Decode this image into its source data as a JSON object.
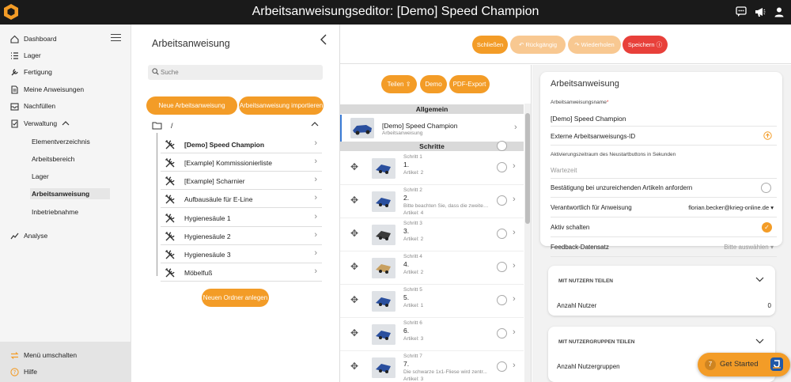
{
  "app": {
    "title": "Arbeitsanweisungseditor: [Demo] Speed Champion"
  },
  "sidebar": {
    "items": [
      {
        "label": "Dashboard",
        "icon": "dashboard-icon"
      },
      {
        "label": "Lager",
        "icon": "list-icon"
      },
      {
        "label": "Fertigung",
        "icon": "wrench-icon"
      },
      {
        "label": "Meine Anweisungen",
        "icon": "document-icon"
      },
      {
        "label": "Nachfüllen",
        "icon": "inbox-icon"
      },
      {
        "label": "Verwaltung",
        "icon": "checklist-icon"
      }
    ],
    "subitems": [
      "Elementverzeichnis",
      "Arbeitsbereich",
      "Lager",
      "Arbeitsanweisung",
      "Inbetriebnahme"
    ],
    "analyse": "Analyse",
    "footer": {
      "switch_menu": "Menü umschalten",
      "help": "Hilfe"
    }
  },
  "tree_panel": {
    "title": "Arbeitsanweisung",
    "search_placeholder": "Suche",
    "create_button": "Neue Arbeitsanweisung erstellen",
    "import_button": "Arbeitsanweisung importieren",
    "folder": "/",
    "items": [
      "[Demo] Speed Champion",
      "[Example] Kommissionierliste",
      "[Example] Scharnier",
      "Aufbausäule für E-Line",
      "Hygienesäule 1",
      "Hygienesäule 2",
      "Hygienesäule 3",
      "Möbelfuß"
    ],
    "new_folder_button": "Neuen Ordner anlegen"
  },
  "toolbar": {
    "close": "Schließen",
    "undo": "Rückgängig",
    "redo": "Wiederholen",
    "save": "Speichern"
  },
  "steps_panel": {
    "share": "Teilen",
    "demo": "Demo",
    "pdf": "PDF-Export",
    "general_header": "Allgemein",
    "general_title": "[Demo] Speed Champion",
    "general_sub": "Arbeitsanweisung",
    "steps_header": "Schritte",
    "steps": [
      {
        "small": "Schritt 1",
        "num": "1.",
        "desc": "",
        "art": "Artikel: 2"
      },
      {
        "small": "Schritt 2",
        "num": "2.",
        "desc": "Bitte beachten Sie, dass die zweite ...",
        "art": "Artikel: 4"
      },
      {
        "small": "Schritt 3",
        "num": "3.",
        "desc": "",
        "art": "Artikel: 2"
      },
      {
        "small": "Schritt 4",
        "num": "4.",
        "desc": "",
        "art": "Artikel: 2"
      },
      {
        "small": "Schritt 5",
        "num": "5.",
        "desc": "",
        "art": "Artikel: 1"
      },
      {
        "small": "Schritt 6",
        "num": "6.",
        "desc": "",
        "art": "Artikel: 3"
      },
      {
        "small": "Schritt 7",
        "num": "7.",
        "desc": "Die schwarze 1x1-Fliese wird zentr...",
        "art": "Artikel: 3"
      }
    ]
  },
  "details": {
    "title": "Arbeitsanweisung",
    "name_label": "Arbeitsanweisungsname",
    "name_required": "*",
    "name_value": "[Demo] Speed Champion",
    "external_id": "Externe Arbeitsanweisungs-ID",
    "activation_label": "Aktivierungszeitraum des Neustartbuttons in Sekunden",
    "wait_placeholder": "Wartezeit",
    "confirm_label": "Bestätigung bei unzureichenden Artikeln anfordern",
    "responsible_label": "Verantwortlich für Anweisung",
    "responsible_value": "florian.becker@krieg-online.de",
    "active_label": "Aktiv schalten",
    "feedback_label": "Feedback-Datensatz",
    "feedback_placeholder": "Bitte auswählen",
    "share_users_title": "MIT NUTZERN TEILEN",
    "users_count_label": "Anzahl Nutzer",
    "users_count": "0",
    "share_groups_title": "MIT NUTZERGRUPPEN TEILEN",
    "groups_count_label": "Anzahl Nutzergruppen"
  },
  "get_started": {
    "count": "7",
    "label": "Get Started"
  },
  "colors": {
    "accent": "#f39c27",
    "save": "#e8403a",
    "disabled": "#f8c891",
    "topbar": "#1a1a1a"
  }
}
